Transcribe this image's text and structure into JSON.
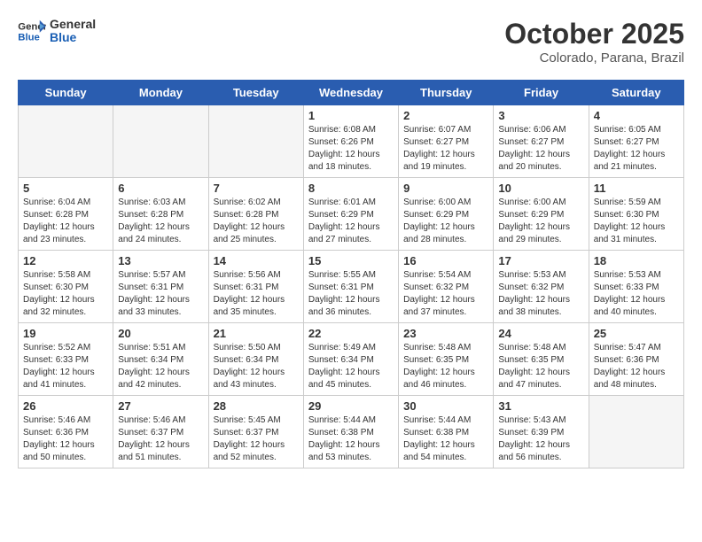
{
  "header": {
    "logo_line1": "General",
    "logo_line2": "Blue",
    "month": "October 2025",
    "location": "Colorado, Parana, Brazil"
  },
  "days_of_week": [
    "Sunday",
    "Monday",
    "Tuesday",
    "Wednesday",
    "Thursday",
    "Friday",
    "Saturday"
  ],
  "weeks": [
    [
      {
        "day": "",
        "empty": true
      },
      {
        "day": "",
        "empty": true
      },
      {
        "day": "",
        "empty": true
      },
      {
        "day": "1",
        "sunrise": "Sunrise: 6:08 AM",
        "sunset": "Sunset: 6:26 PM",
        "daylight": "Daylight: 12 hours and 18 minutes."
      },
      {
        "day": "2",
        "sunrise": "Sunrise: 6:07 AM",
        "sunset": "Sunset: 6:27 PM",
        "daylight": "Daylight: 12 hours and 19 minutes."
      },
      {
        "day": "3",
        "sunrise": "Sunrise: 6:06 AM",
        "sunset": "Sunset: 6:27 PM",
        "daylight": "Daylight: 12 hours and 20 minutes."
      },
      {
        "day": "4",
        "sunrise": "Sunrise: 6:05 AM",
        "sunset": "Sunset: 6:27 PM",
        "daylight": "Daylight: 12 hours and 21 minutes."
      }
    ],
    [
      {
        "day": "5",
        "sunrise": "Sunrise: 6:04 AM",
        "sunset": "Sunset: 6:28 PM",
        "daylight": "Daylight: 12 hours and 23 minutes."
      },
      {
        "day": "6",
        "sunrise": "Sunrise: 6:03 AM",
        "sunset": "Sunset: 6:28 PM",
        "daylight": "Daylight: 12 hours and 24 minutes."
      },
      {
        "day": "7",
        "sunrise": "Sunrise: 6:02 AM",
        "sunset": "Sunset: 6:28 PM",
        "daylight": "Daylight: 12 hours and 25 minutes."
      },
      {
        "day": "8",
        "sunrise": "Sunrise: 6:01 AM",
        "sunset": "Sunset: 6:29 PM",
        "daylight": "Daylight: 12 hours and 27 minutes."
      },
      {
        "day": "9",
        "sunrise": "Sunrise: 6:00 AM",
        "sunset": "Sunset: 6:29 PM",
        "daylight": "Daylight: 12 hours and 28 minutes."
      },
      {
        "day": "10",
        "sunrise": "Sunrise: 6:00 AM",
        "sunset": "Sunset: 6:29 PM",
        "daylight": "Daylight: 12 hours and 29 minutes."
      },
      {
        "day": "11",
        "sunrise": "Sunrise: 5:59 AM",
        "sunset": "Sunset: 6:30 PM",
        "daylight": "Daylight: 12 hours and 31 minutes."
      }
    ],
    [
      {
        "day": "12",
        "sunrise": "Sunrise: 5:58 AM",
        "sunset": "Sunset: 6:30 PM",
        "daylight": "Daylight: 12 hours and 32 minutes."
      },
      {
        "day": "13",
        "sunrise": "Sunrise: 5:57 AM",
        "sunset": "Sunset: 6:31 PM",
        "daylight": "Daylight: 12 hours and 33 minutes."
      },
      {
        "day": "14",
        "sunrise": "Sunrise: 5:56 AM",
        "sunset": "Sunset: 6:31 PM",
        "daylight": "Daylight: 12 hours and 35 minutes."
      },
      {
        "day": "15",
        "sunrise": "Sunrise: 5:55 AM",
        "sunset": "Sunset: 6:31 PM",
        "daylight": "Daylight: 12 hours and 36 minutes."
      },
      {
        "day": "16",
        "sunrise": "Sunrise: 5:54 AM",
        "sunset": "Sunset: 6:32 PM",
        "daylight": "Daylight: 12 hours and 37 minutes."
      },
      {
        "day": "17",
        "sunrise": "Sunrise: 5:53 AM",
        "sunset": "Sunset: 6:32 PM",
        "daylight": "Daylight: 12 hours and 38 minutes."
      },
      {
        "day": "18",
        "sunrise": "Sunrise: 5:53 AM",
        "sunset": "Sunset: 6:33 PM",
        "daylight": "Daylight: 12 hours and 40 minutes."
      }
    ],
    [
      {
        "day": "19",
        "sunrise": "Sunrise: 5:52 AM",
        "sunset": "Sunset: 6:33 PM",
        "daylight": "Daylight: 12 hours and 41 minutes."
      },
      {
        "day": "20",
        "sunrise": "Sunrise: 5:51 AM",
        "sunset": "Sunset: 6:34 PM",
        "daylight": "Daylight: 12 hours and 42 minutes."
      },
      {
        "day": "21",
        "sunrise": "Sunrise: 5:50 AM",
        "sunset": "Sunset: 6:34 PM",
        "daylight": "Daylight: 12 hours and 43 minutes."
      },
      {
        "day": "22",
        "sunrise": "Sunrise: 5:49 AM",
        "sunset": "Sunset: 6:34 PM",
        "daylight": "Daylight: 12 hours and 45 minutes."
      },
      {
        "day": "23",
        "sunrise": "Sunrise: 5:48 AM",
        "sunset": "Sunset: 6:35 PM",
        "daylight": "Daylight: 12 hours and 46 minutes."
      },
      {
        "day": "24",
        "sunrise": "Sunrise: 5:48 AM",
        "sunset": "Sunset: 6:35 PM",
        "daylight": "Daylight: 12 hours and 47 minutes."
      },
      {
        "day": "25",
        "sunrise": "Sunrise: 5:47 AM",
        "sunset": "Sunset: 6:36 PM",
        "daylight": "Daylight: 12 hours and 48 minutes."
      }
    ],
    [
      {
        "day": "26",
        "sunrise": "Sunrise: 5:46 AM",
        "sunset": "Sunset: 6:36 PM",
        "daylight": "Daylight: 12 hours and 50 minutes."
      },
      {
        "day": "27",
        "sunrise": "Sunrise: 5:46 AM",
        "sunset": "Sunset: 6:37 PM",
        "daylight": "Daylight: 12 hours and 51 minutes."
      },
      {
        "day": "28",
        "sunrise": "Sunrise: 5:45 AM",
        "sunset": "Sunset: 6:37 PM",
        "daylight": "Daylight: 12 hours and 52 minutes."
      },
      {
        "day": "29",
        "sunrise": "Sunrise: 5:44 AM",
        "sunset": "Sunset: 6:38 PM",
        "daylight": "Daylight: 12 hours and 53 minutes."
      },
      {
        "day": "30",
        "sunrise": "Sunrise: 5:44 AM",
        "sunset": "Sunset: 6:38 PM",
        "daylight": "Daylight: 12 hours and 54 minutes."
      },
      {
        "day": "31",
        "sunrise": "Sunrise: 5:43 AM",
        "sunset": "Sunset: 6:39 PM",
        "daylight": "Daylight: 12 hours and 56 minutes."
      },
      {
        "day": "",
        "empty": true
      }
    ]
  ]
}
